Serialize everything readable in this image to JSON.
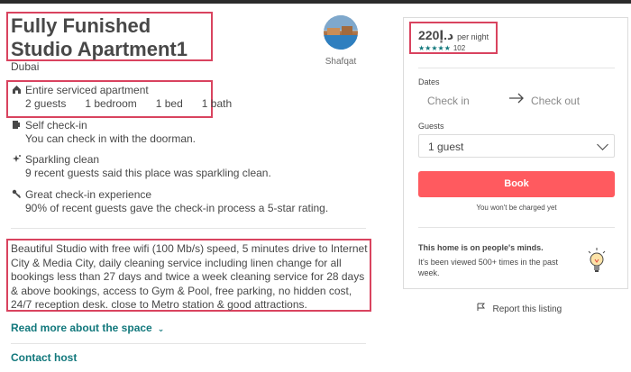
{
  "listing": {
    "title": "Fully Funished Studio Apartment1",
    "city": "Dubai"
  },
  "host": {
    "name": "Shafqat",
    "avatar_icon": "host-photo"
  },
  "features": [
    {
      "icon": "home-icon",
      "title": "Entire serviced apartment",
      "specs": [
        "2 guests",
        "1 bedroom",
        "1 bed",
        "1 bath"
      ]
    },
    {
      "icon": "door-icon",
      "title": "Self check-in",
      "desc": "You can check in with the doorman."
    },
    {
      "icon": "sparkle-icon",
      "title": "Sparkling clean",
      "desc": "9 recent guests said this place was sparkling clean."
    },
    {
      "icon": "key-icon",
      "title": "Great check-in experience",
      "desc": "90% of recent guests gave the check-in process a 5-star rating."
    }
  ],
  "description": "Beautiful Studio with free wifi (100 Mb/s) speed, 5 minutes drive to Internet City & Media City, daily cleaning service including linen change for all bookings less than 27 days and twice a week cleaning service for 28 days & above bookings, access to Gym & Pool, free parking, no hidden cost, 24/7 reception desk. close to Metro station & good attractions.",
  "links": {
    "read_more": "Read more about the space",
    "contact_host": "Contact host"
  },
  "booking": {
    "price": "220د.إ",
    "per_night": "per night",
    "stars": "★★★★★",
    "rating": 5,
    "review_count": "102",
    "dates_label": "Dates",
    "check_in": "Check in",
    "check_out": "Check out",
    "guests_label": "Guests",
    "guests_value": "1 guest",
    "book_label": "Book",
    "not_charged": "You won't be charged yet",
    "minds_title": "This home is on people's minds.",
    "minds_desc": "It's been viewed 500+ times in the past week.",
    "report": "Report this listing"
  },
  "colors": {
    "accent": "#ff5a5f",
    "teal": "#12787c",
    "highlight": "#d9435f",
    "text": "#484848"
  }
}
